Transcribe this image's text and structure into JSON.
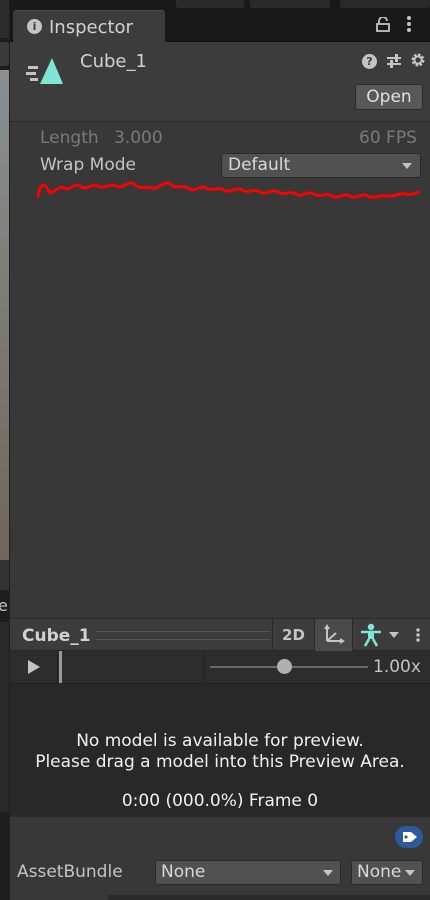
{
  "window": {
    "tab_title": "Inspector"
  },
  "header": {
    "asset_name": "Cube_1",
    "open_label": "Open"
  },
  "clip": {
    "length_label": "Length",
    "length_value": "3.000",
    "fps_label": "60 FPS",
    "wrap_mode_label": "Wrap Mode",
    "wrap_mode_value": "Default"
  },
  "annotation": {
    "color": "#ff0000"
  },
  "preview": {
    "title": "Cube_1",
    "mode_2d_label": "2D",
    "speed_label": "1.00x",
    "speed_fraction": 0.47,
    "message_line1": "No model is available for preview.",
    "message_line2": "Please drag a model into this Preview Area.",
    "frame_info": "0:00 (000.0%) Frame 0"
  },
  "asset_bundle": {
    "label": "AssetBundle",
    "name_value": "None",
    "variant_value": "None"
  },
  "side": {
    "edge_glyph": "e"
  },
  "icons": {
    "info": "info-icon",
    "lock": "lock-icon",
    "menu": "kebab-menu-icon",
    "asset": "animation-clip-icon",
    "help": "help-icon",
    "preset": "preset-sliders-icon",
    "settings": "gear-icon",
    "pivot": "pivot-axes-icon",
    "avatar": "avatar-icon",
    "tag": "tag-icon",
    "play": "play-icon"
  },
  "colors": {
    "accent_teal": "#7fe6d6",
    "tag_blue": "#2d5a9e",
    "panel_bg": "#383838"
  }
}
